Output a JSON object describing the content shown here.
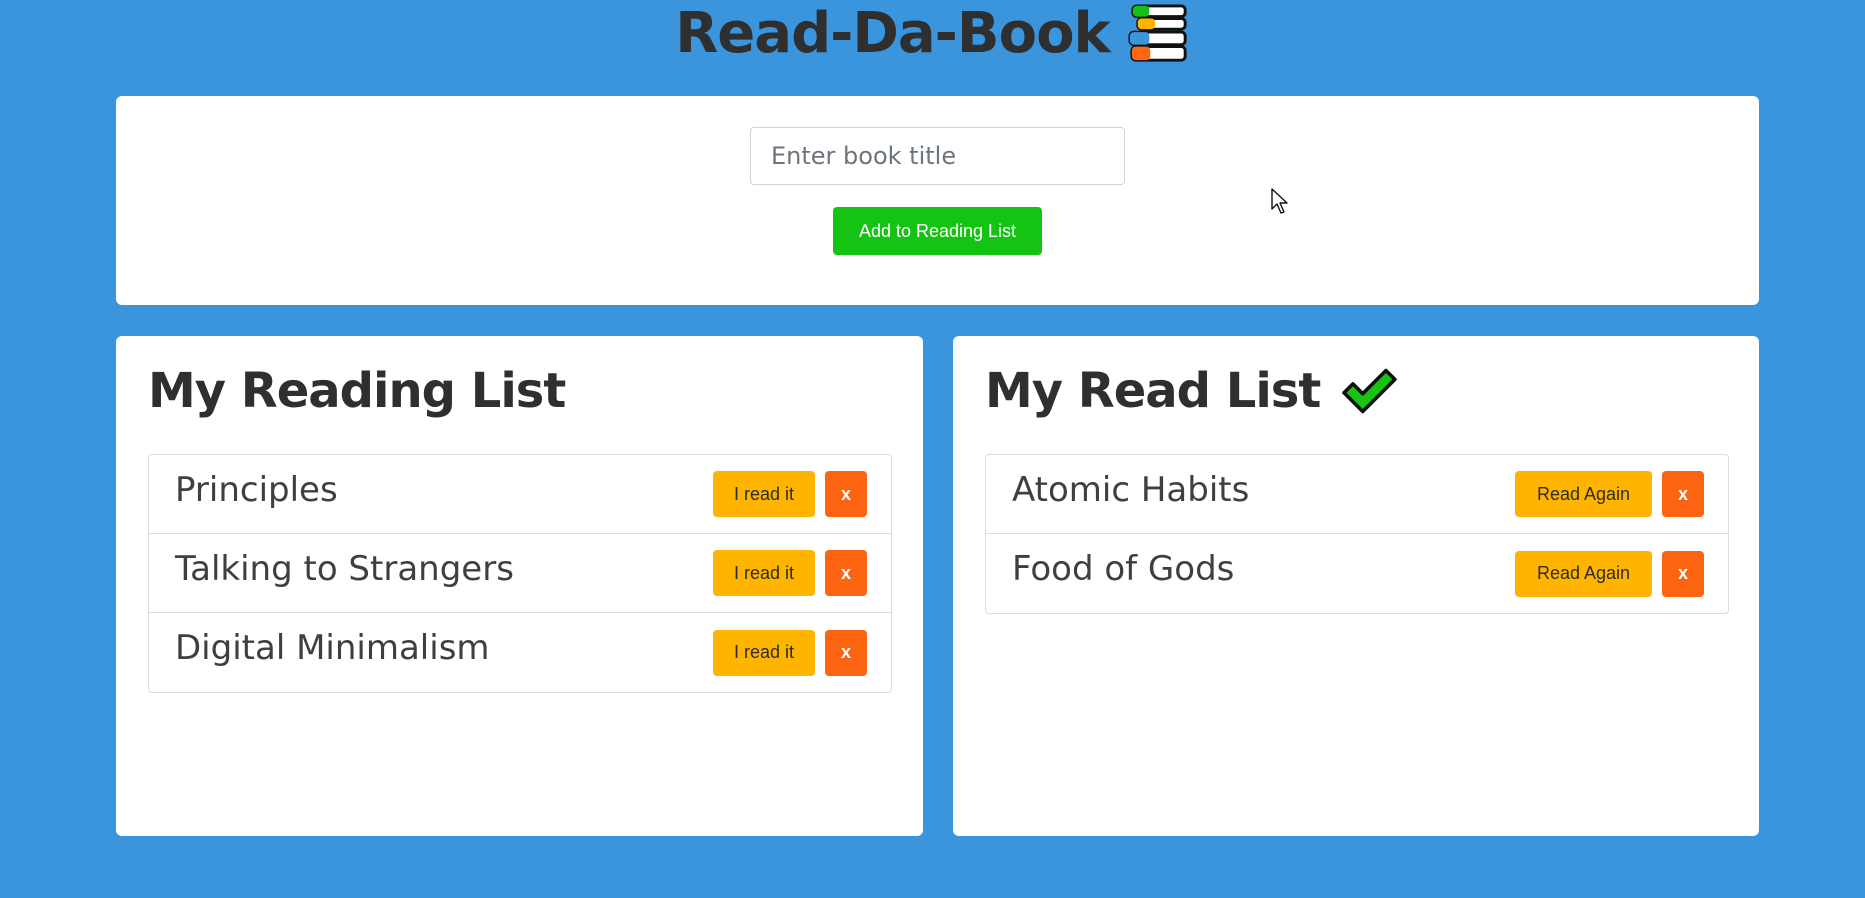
{
  "app": {
    "title": "Read-Da-Book"
  },
  "entry": {
    "placeholder": "Enter book title",
    "value": "",
    "button_label": "Add to Reading List"
  },
  "reading_list": {
    "heading": "My Reading List",
    "items": [
      {
        "title": "Principles",
        "primary_action": "I read it",
        "remove_action": "x"
      },
      {
        "title": "Talking to Strangers",
        "primary_action": "I read it",
        "remove_action": "x"
      },
      {
        "title": "Digital Minimalism",
        "primary_action": "I read it",
        "remove_action": "x"
      }
    ]
  },
  "read_list": {
    "heading": "My Read List",
    "items": [
      {
        "title": "Atomic Habits",
        "primary_action": "Read Again",
        "remove_action": "x"
      },
      {
        "title": "Food of Gods",
        "primary_action": "Read Again",
        "remove_action": "x"
      }
    ]
  },
  "icons": {
    "title_icon": "books-icon",
    "read_heading_icon": "checkmark-icon",
    "pointer": "cursor-icon"
  },
  "colors": {
    "background": "#3b95dd",
    "add_button": "#15c313",
    "read_button": "#ffb400",
    "remove_button": "#fd6411",
    "check_icon": "#18c313"
  }
}
